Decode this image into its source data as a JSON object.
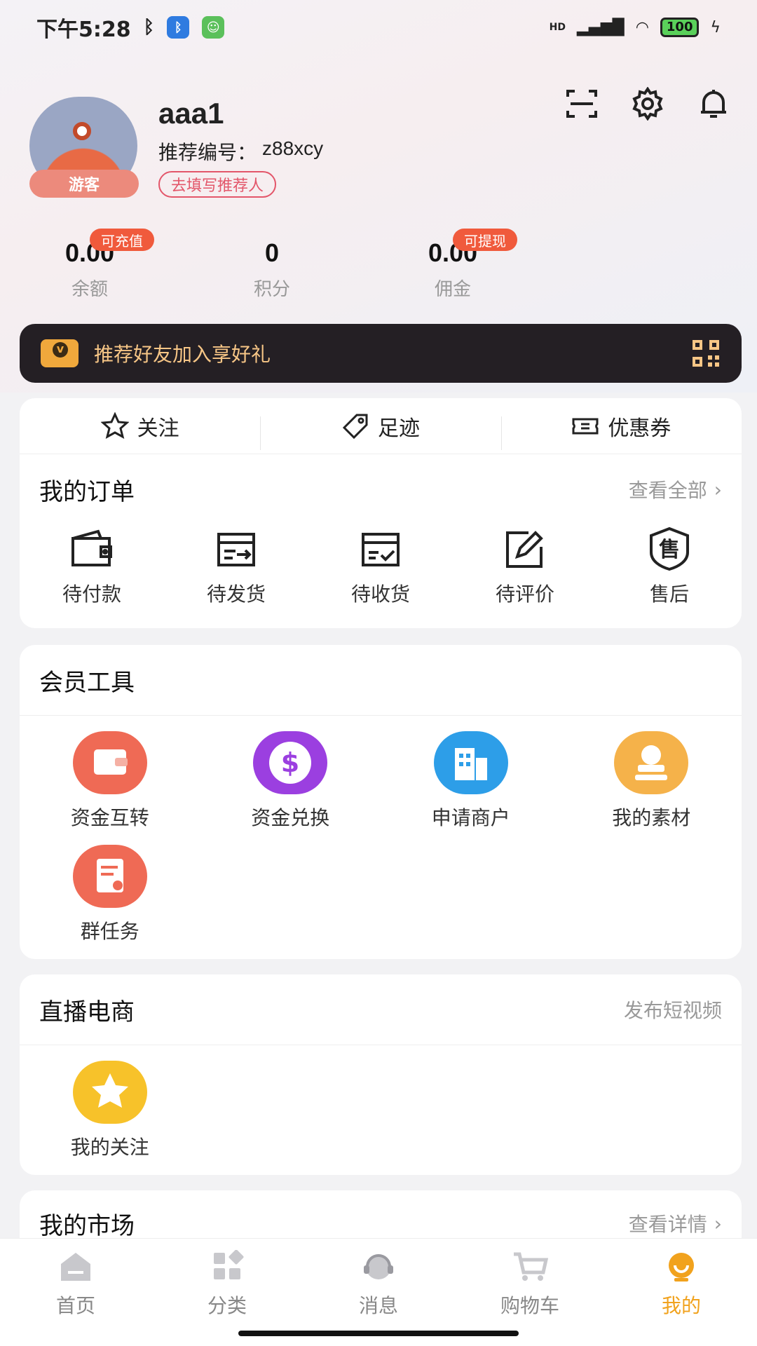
{
  "status_bar": {
    "time": "下午5:28",
    "network": "HD",
    "battery": "100",
    "colors": {
      "bluetooth_badge": "#2f7be0",
      "app_badge": "#5bc05b"
    }
  },
  "profile": {
    "username": "aaa1",
    "guest_tag": "游客",
    "ref_label": "推荐编号：",
    "ref_code": "z88xcy",
    "fill_referrer": "去填写推荐人",
    "icons": [
      "scan-icon",
      "gear-icon",
      "bell-icon"
    ]
  },
  "stats": [
    {
      "value": "0.00",
      "label": "余额",
      "tip": "可充值"
    },
    {
      "value": "0",
      "label": "积分",
      "tip": ""
    },
    {
      "value": "0.00",
      "label": "佣金",
      "tip": "可提现"
    }
  ],
  "invite": {
    "text": "推荐好友加入享好礼",
    "colors": {
      "bg": "#241f24",
      "text": "#f7c686"
    }
  },
  "quick_links": [
    {
      "label": "关注",
      "icon": "star-outline-icon"
    },
    {
      "label": "足迹",
      "icon": "tag-icon"
    },
    {
      "label": "优惠券",
      "icon": "coupon-icon"
    }
  ],
  "orders": {
    "title": "我的订单",
    "view_all": "查看全部",
    "items": [
      {
        "label": "待付款",
        "icon": "wallet-icon"
      },
      {
        "label": "待发货",
        "icon": "ship-box-icon"
      },
      {
        "label": "待收货",
        "icon": "receive-box-icon"
      },
      {
        "label": "待评价",
        "icon": "edit-icon"
      },
      {
        "label": "售后",
        "icon": "after-sale-icon",
        "glyph": "售"
      }
    ]
  },
  "member_tools": {
    "title": "会员工具",
    "items": [
      {
        "label": "资金互转",
        "icon": "wallet-transfer-icon",
        "color": "#ef6a55"
      },
      {
        "label": "资金兑换",
        "icon": "dollar-icon",
        "color": "#9b3fe0"
      },
      {
        "label": "申请商户",
        "icon": "building-icon",
        "color": "#2d9ee8"
      },
      {
        "label": "我的素材",
        "icon": "stamp-icon",
        "color": "#f5b24a"
      },
      {
        "label": "群任务",
        "icon": "task-list-icon",
        "color": "#ef6a55"
      }
    ]
  },
  "live": {
    "title": "直播电商",
    "link": "发布短视频",
    "items": [
      {
        "label": "我的关注",
        "icon": "star-badge-icon",
        "color": "#f7c22a"
      }
    ]
  },
  "market": {
    "title": "我的市场",
    "link": "查看详情"
  },
  "tabbar": {
    "active_color": "#f1a21d",
    "items": [
      {
        "label": "首页",
        "icon": "home-icon",
        "active": false
      },
      {
        "label": "分类",
        "icon": "category-icon",
        "active": false
      },
      {
        "label": "消息",
        "icon": "message-headset-icon",
        "active": false
      },
      {
        "label": "购物车",
        "icon": "cart-icon",
        "active": false
      },
      {
        "label": "我的",
        "icon": "profile-icon",
        "active": true
      }
    ]
  }
}
